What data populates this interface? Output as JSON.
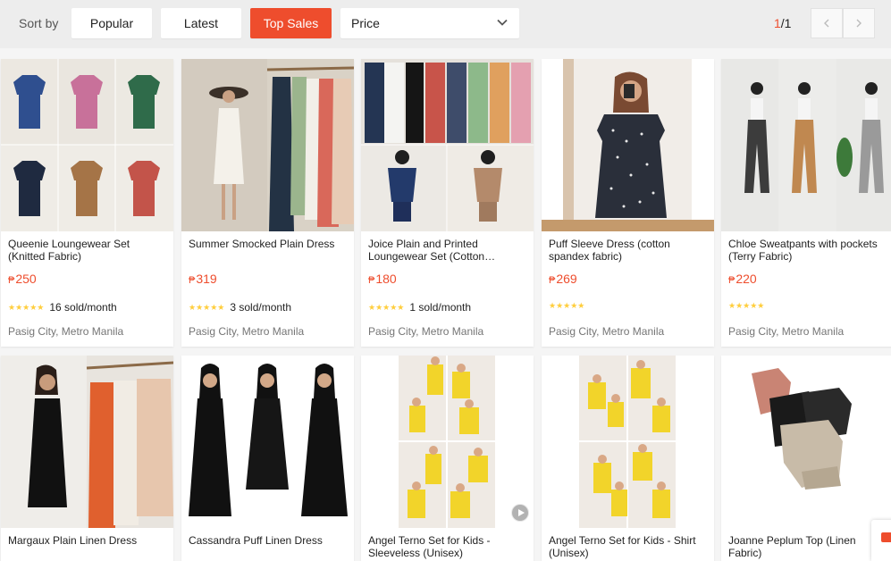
{
  "sort": {
    "label": "Sort by",
    "options": [
      "Popular",
      "Latest",
      "Top Sales"
    ],
    "active": "Top Sales",
    "price_label": "Price"
  },
  "pager": {
    "current": "1",
    "total": "/1"
  },
  "currency": "₱",
  "colors": {
    "accent": "#ee4d2d",
    "star": "#ffce3d"
  },
  "products": [
    {
      "title": "Queenie Loungewear Set (Knitted Fabric)",
      "price": "250",
      "sold": "16 sold/month",
      "location": "Pasig City, Metro Manila"
    },
    {
      "title": "Summer Smocked Plain Dress",
      "price": "319",
      "sold": "3 sold/month",
      "location": "Pasig City, Metro Manila"
    },
    {
      "title": "Joice Plain and Printed Loungewear Set (Cotton…",
      "price": "180",
      "sold": "1 sold/month",
      "location": "Pasig City, Metro Manila"
    },
    {
      "title": "Puff Sleeve Dress (cotton spandex fabric)",
      "price": "269",
      "sold": "",
      "location": "Pasig City, Metro Manila"
    },
    {
      "title": "Chloe Sweatpants with pockets (Terry Fabric)",
      "price": "220",
      "sold": "",
      "location": "Pasig City, Metro Manila"
    },
    {
      "title": "Margaux Plain Linen Dress"
    },
    {
      "title": "Cassandra Puff Linen Dress"
    },
    {
      "title": "Angel Terno Set for Kids - Sleeveless (Unisex)"
    },
    {
      "title": "Angel Terno Set for Kids - Shirt (Unisex)"
    },
    {
      "title": "Joanne Peplum Top (Linen Fabric)"
    }
  ]
}
